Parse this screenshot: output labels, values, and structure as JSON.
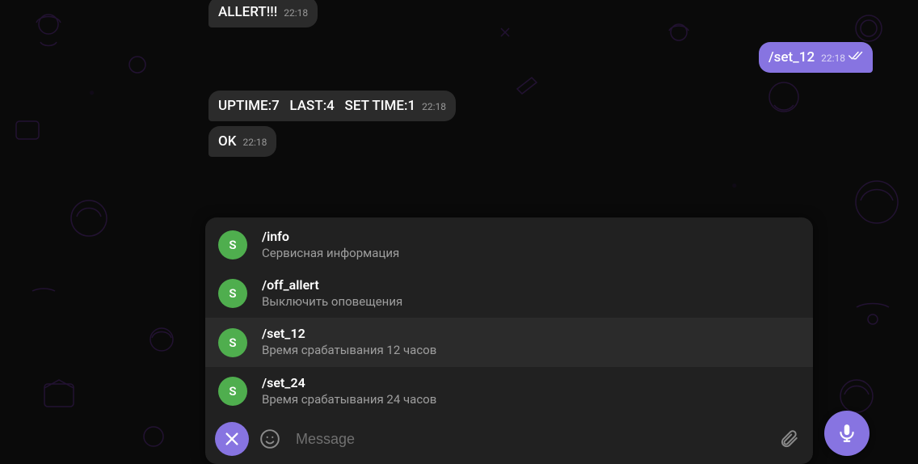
{
  "messages": [
    {
      "side": "in",
      "text": "ALLERT!!!",
      "time": "22:18"
    },
    {
      "side": "out",
      "text": "/set_12",
      "time": "22:18",
      "read": true
    },
    {
      "side": "in",
      "text": "UPTIME:7   LAST:4   SET TIME:1",
      "time": "22:18"
    },
    {
      "side": "in",
      "text": "OK",
      "time": "22:18"
    }
  ],
  "commands": [
    {
      "avatar": "S",
      "name": "/info",
      "desc": "Сервисная информация"
    },
    {
      "avatar": "S",
      "name": "/off_allert",
      "desc": "Выключить оповещения"
    },
    {
      "avatar": "S",
      "name": "/set_12",
      "desc": "Время срабатывания 12 часов",
      "hover": true
    },
    {
      "avatar": "S",
      "name": "/set_24",
      "desc": "Время срабатывания 24 часов"
    }
  ],
  "input": {
    "placeholder": "Message"
  }
}
